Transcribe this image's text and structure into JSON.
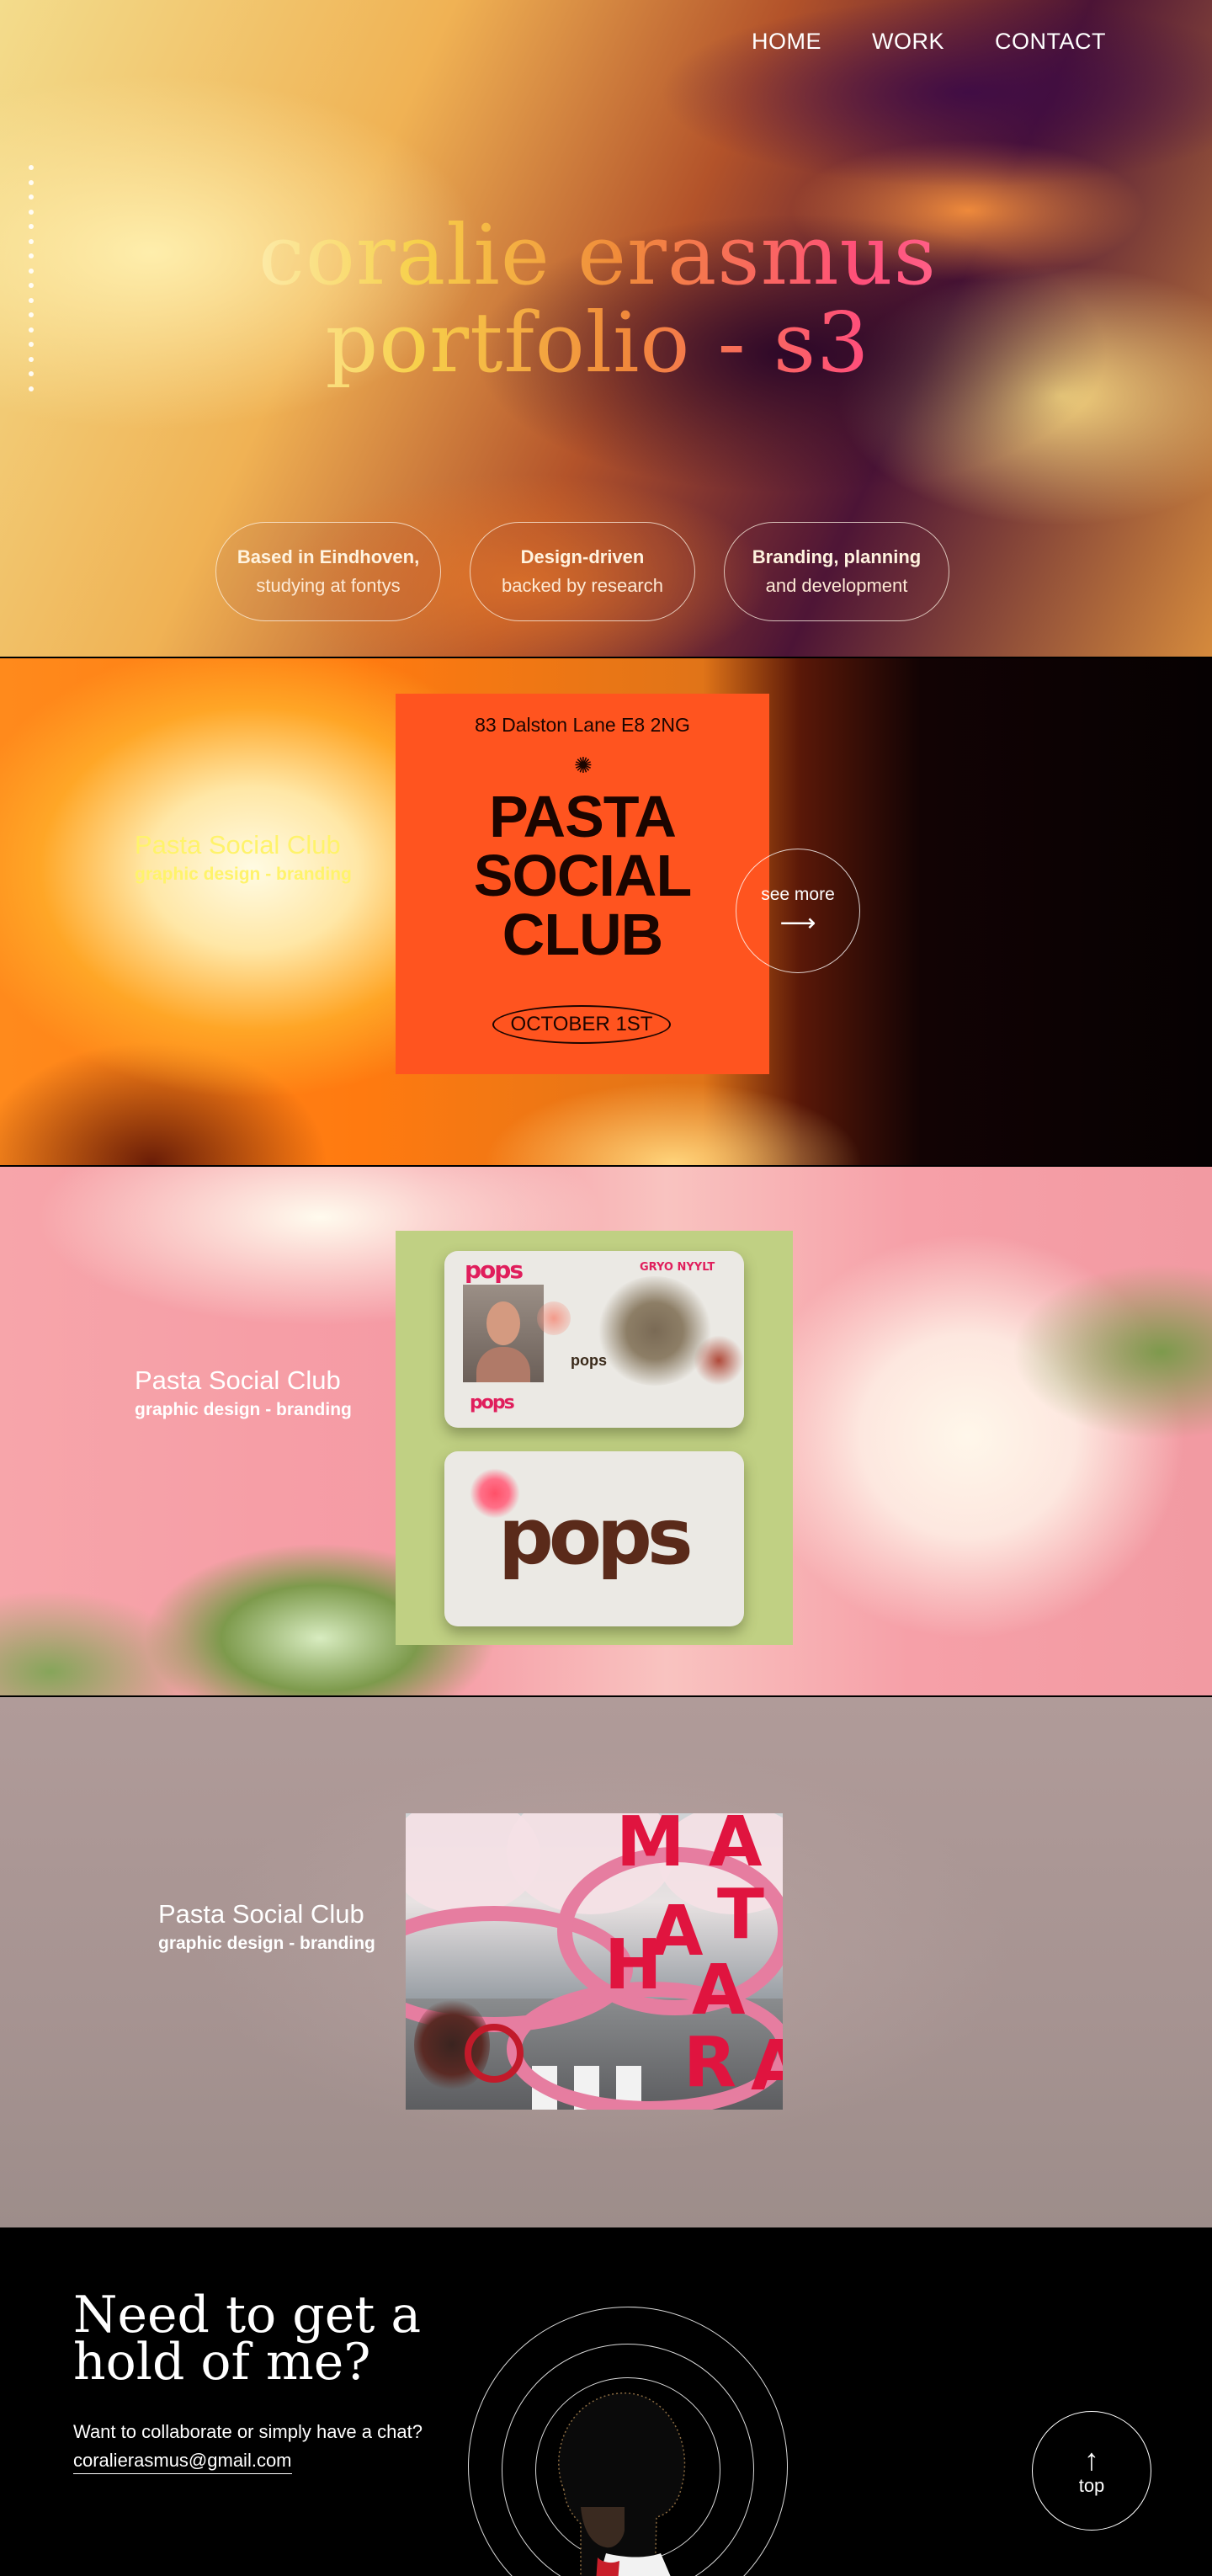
{
  "nav": {
    "home": "HOME",
    "work": "WORK",
    "contact": "CONTACT"
  },
  "hero": {
    "title_line1": "coralie erasmus",
    "title_line2": "portfolio - s3",
    "pills": [
      {
        "bold": "Based in Eindhoven,",
        "text": "studying at fontys"
      },
      {
        "bold": "Design-driven",
        "text": "backed by research"
      },
      {
        "bold": "Branding, planning",
        "text": "and development"
      }
    ]
  },
  "projects": [
    {
      "title": "Pasta Social Club",
      "subtitle": "graphic design - branding",
      "card": {
        "address": "83 Dalston Lane E8 2NG",
        "line1": "PASTA",
        "line2": "SOCIAL",
        "line3": "CLUB",
        "date": "OCTOBER 1ST"
      },
      "see_more": "see more"
    },
    {
      "title": "Pasta Social Club",
      "subtitle": "graphic design - branding",
      "card": {
        "logo": "pops",
        "top_label": "GRYO NYYLT"
      }
    },
    {
      "title": "Pasta Social Club",
      "subtitle": "graphic design - branding",
      "card": {
        "letters": [
          "M",
          "A",
          "T",
          "A",
          "H",
          "A",
          "R",
          "A"
        ]
      }
    }
  ],
  "footer": {
    "title": "Need to get a hold of me?",
    "text": "Want to collaborate or simply have a chat?",
    "email": "coralierasmus@gmail.com",
    "top_label": "top"
  },
  "icons": {
    "arrow_right": "arrow-right-icon",
    "arrow_up": "arrow-up-icon",
    "star": "star-icon"
  },
  "colors": {
    "accent_yellow": "#fff36b",
    "card_orange": "#ff541f",
    "card_green": "#c0d083",
    "ribbon_pink": "#e67da0",
    "brand_red": "#e0143f"
  }
}
